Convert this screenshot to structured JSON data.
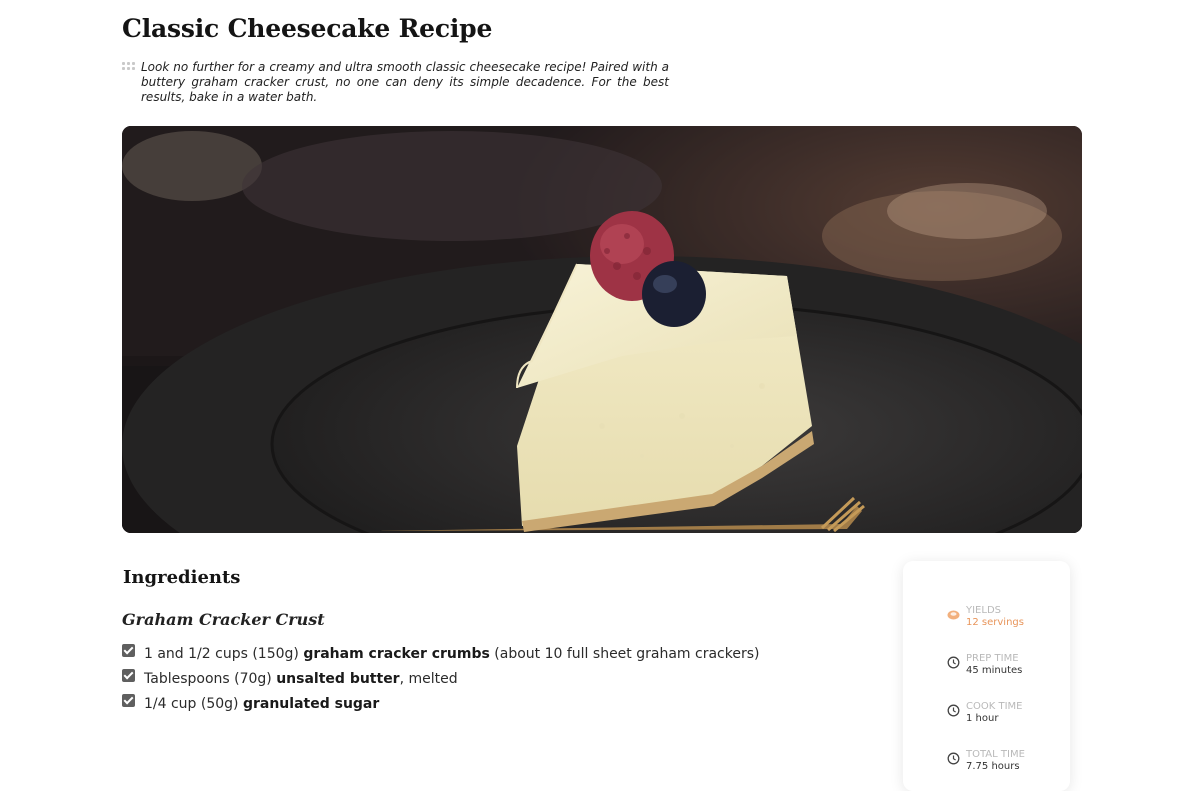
{
  "recipe": {
    "title": "Classic Cheesecake Recipe",
    "intro": "Look no further for a creamy and ultra smooth classic cheesecake recipe! Paired with a buttery graham cracker crust, no one can deny its simple decadence. For the best results, bake in a water bath."
  },
  "ingredients": {
    "heading": "Ingredients",
    "groups": [
      {
        "title": "Graham Cracker Crust",
        "items": [
          {
            "pre": "1 and 1/2 cups (150g) ",
            "bold": "graham cracker crumbs",
            "post": " (about 10 full sheet graham crackers)",
            "checked": true
          },
          {
            "pre": "Tablespoons (70g) ",
            "bold": "unsalted butter",
            "post": ", melted",
            "checked": true
          },
          {
            "pre": "1/4 cup (50g) ",
            "bold": "granulated sugar",
            "post": "",
            "checked": true
          }
        ]
      }
    ]
  },
  "meta": {
    "yields": {
      "label": "YIELDS",
      "value": "12 servings",
      "icon": "servings-icon"
    },
    "prep": {
      "label": "PREP TIME",
      "value": "45 minutes",
      "icon": "clock-icon"
    },
    "cook": {
      "label": "COOK TIME",
      "value": "1 hour",
      "icon": "clock-icon"
    },
    "total": {
      "label": "TOTAL TIME",
      "value": "7.75 hours",
      "icon": "clock-icon"
    }
  },
  "colors": {
    "accent": "#e8955b",
    "label_gray": "#b9b9b9"
  }
}
